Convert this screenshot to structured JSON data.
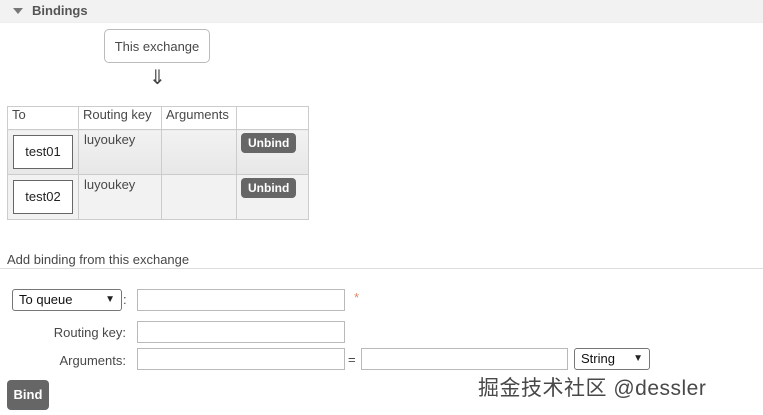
{
  "section": {
    "title": "Bindings"
  },
  "diagram": {
    "exchange_label": "This exchange",
    "arrow": "⇓"
  },
  "table": {
    "headers": [
      "To",
      "Routing key",
      "Arguments",
      ""
    ],
    "rows": [
      {
        "to": "test01",
        "routing_key": "luyoukey",
        "arguments": "",
        "action": "Unbind"
      },
      {
        "to": "test02",
        "routing_key": "luyoukey",
        "arguments": "",
        "action": "Unbind"
      }
    ]
  },
  "add_binding": {
    "title": "Add binding from this exchange",
    "destination_type": "To queue",
    "destination_value": "",
    "required_marker": "*",
    "routing_key_label": "Routing key:",
    "routing_key_value": "",
    "arguments_label": "Arguments:",
    "argument_key": "",
    "equals": "=",
    "argument_value": "",
    "argument_type": "String",
    "bind_label": "Bind"
  },
  "watermark": "掘金技术社区 @dessler"
}
